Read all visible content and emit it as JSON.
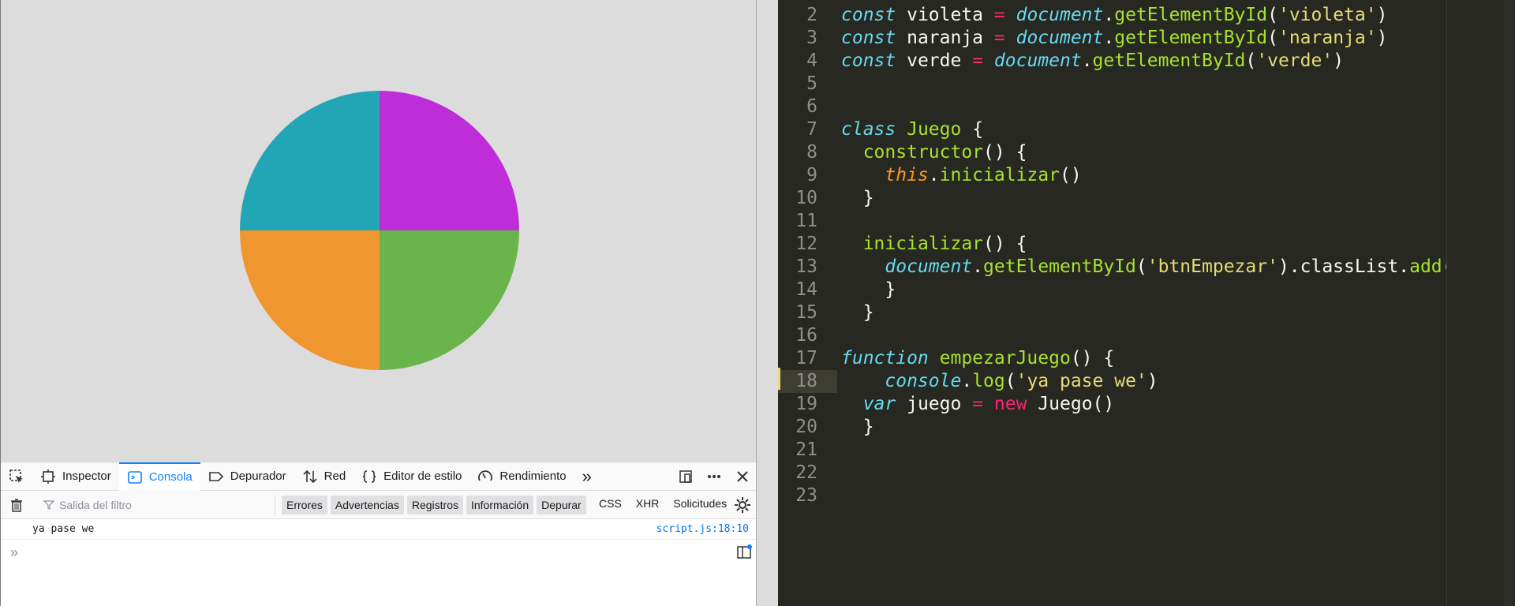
{
  "game": {
    "colors": {
      "celeste": "#22a6b6",
      "violeta": "#bf2dd8",
      "naranja": "#f0962f",
      "verde": "#6ab44c"
    },
    "background": "#dddcdd"
  },
  "devtools": {
    "tabs": [
      {
        "label": "Inspector",
        "icon": "inspector-icon"
      },
      {
        "label": "Consola",
        "icon": "console-icon",
        "active": true
      },
      {
        "label": "Depurador",
        "icon": "debugger-icon"
      },
      {
        "label": "Red",
        "icon": "network-icon"
      },
      {
        "label": "Editor de estilo",
        "icon": "style-editor-icon"
      },
      {
        "label": "Rendimiento",
        "icon": "performance-icon"
      }
    ],
    "more": "»",
    "filter_placeholder": "Salida del filtro",
    "filter_buttons": [
      "Errores",
      "Advertencias",
      "Registros",
      "Información",
      "Depurar"
    ],
    "net_filters": [
      "CSS",
      "XHR",
      "Solicitudes"
    ],
    "log": {
      "message": "ya pase we",
      "source": "script.js:18:10"
    },
    "prompt": "»"
  },
  "editor": {
    "lines": [
      {
        "n": "2",
        "tokens": [
          [
            "kw",
            "const"
          ],
          [
            "p",
            " violeta "
          ],
          [
            "op",
            "="
          ],
          [
            "p",
            " "
          ],
          [
            "it",
            "document"
          ],
          [
            "p",
            "."
          ],
          [
            "fn",
            "getElementById"
          ],
          [
            "p",
            "("
          ],
          [
            "str",
            "'violeta'"
          ],
          [
            "p",
            ")"
          ]
        ]
      },
      {
        "n": "3",
        "tokens": [
          [
            "kw",
            "const"
          ],
          [
            "p",
            " naranja "
          ],
          [
            "op",
            "="
          ],
          [
            "p",
            " "
          ],
          [
            "it",
            "document"
          ],
          [
            "p",
            "."
          ],
          [
            "fn",
            "getElementById"
          ],
          [
            "p",
            "("
          ],
          [
            "str",
            "'naranja'"
          ],
          [
            "p",
            ")"
          ]
        ]
      },
      {
        "n": "4",
        "tokens": [
          [
            "kw",
            "const"
          ],
          [
            "p",
            " verde "
          ],
          [
            "op",
            "="
          ],
          [
            "p",
            " "
          ],
          [
            "it",
            "document"
          ],
          [
            "p",
            "."
          ],
          [
            "fn",
            "getElementById"
          ],
          [
            "p",
            "("
          ],
          [
            "str",
            "'verde'"
          ],
          [
            "p",
            ")"
          ]
        ]
      },
      {
        "n": "5",
        "tokens": []
      },
      {
        "n": "6",
        "tokens": []
      },
      {
        "n": "7",
        "tokens": [
          [
            "kw",
            "class"
          ],
          [
            "p",
            " "
          ],
          [
            "cls",
            "Juego"
          ],
          [
            "p",
            " {"
          ]
        ]
      },
      {
        "n": "8",
        "tokens": [
          [
            "p",
            "  "
          ],
          [
            "fn",
            "constructor"
          ],
          [
            "p",
            "() {"
          ]
        ]
      },
      {
        "n": "9",
        "tokens": [
          [
            "p",
            "    "
          ],
          [
            "this",
            "this"
          ],
          [
            "p",
            "."
          ],
          [
            "fn",
            "inicializar"
          ],
          [
            "p",
            "()"
          ]
        ]
      },
      {
        "n": "10",
        "tokens": [
          [
            "p",
            "  }"
          ]
        ]
      },
      {
        "n": "11",
        "tokens": []
      },
      {
        "n": "12",
        "tokens": [
          [
            "p",
            "  "
          ],
          [
            "fn",
            "inicializar"
          ],
          [
            "p",
            "() {"
          ]
        ]
      },
      {
        "n": "13",
        "tokens": [
          [
            "p",
            "    "
          ],
          [
            "it",
            "document"
          ],
          [
            "p",
            "."
          ],
          [
            "fn",
            "getElementById"
          ],
          [
            "p",
            "("
          ],
          [
            "str",
            "'btnEmpezar'"
          ],
          [
            "p",
            ").classList."
          ],
          [
            "fn",
            "add"
          ],
          [
            "p",
            "("
          ]
        ]
      },
      {
        "n": "14",
        "tokens": [
          [
            "p",
            "    }"
          ]
        ]
      },
      {
        "n": "15",
        "tokens": [
          [
            "p",
            "  }"
          ]
        ]
      },
      {
        "n": "16",
        "tokens": []
      },
      {
        "n": "17",
        "tokens": [
          [
            "kw",
            "function"
          ],
          [
            "p",
            " "
          ],
          [
            "fn",
            "empezarJuego"
          ],
          [
            "p",
            "() {"
          ]
        ]
      },
      {
        "n": "18",
        "tokens": [
          [
            "p",
            "    "
          ],
          [
            "it",
            "console"
          ],
          [
            "p",
            "."
          ],
          [
            "fn",
            "log"
          ],
          [
            "p",
            "("
          ],
          [
            "str",
            "'ya pase we'"
          ],
          [
            "p",
            ")"
          ]
        ],
        "current": true
      },
      {
        "n": "19",
        "tokens": [
          [
            "p",
            "  "
          ],
          [
            "kw",
            "var"
          ],
          [
            "p",
            " juego "
          ],
          [
            "op",
            "="
          ],
          [
            "p",
            " "
          ],
          [
            "op",
            "new"
          ],
          [
            "p",
            " Juego()"
          ]
        ]
      },
      {
        "n": "20",
        "tokens": [
          [
            "p",
            "  }"
          ]
        ]
      },
      {
        "n": "21",
        "tokens": []
      },
      {
        "n": "22",
        "tokens": []
      },
      {
        "n": "23",
        "tokens": []
      }
    ]
  }
}
